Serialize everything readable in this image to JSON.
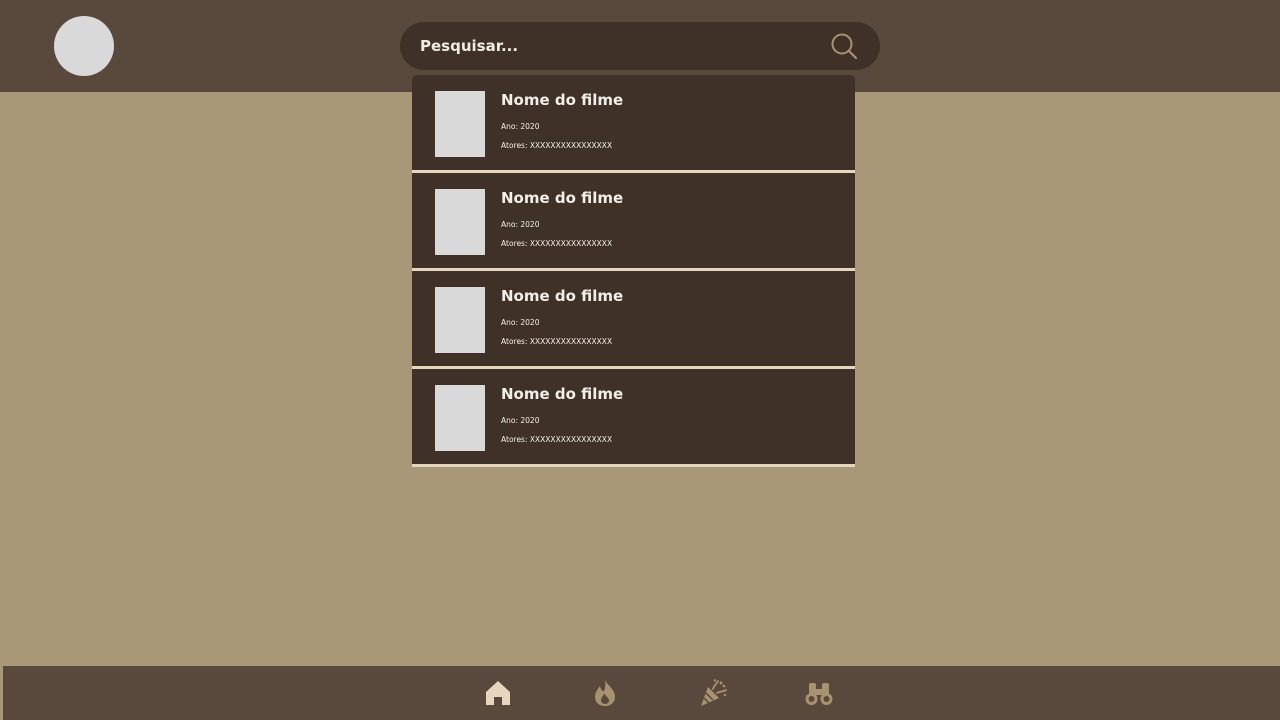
{
  "search": {
    "placeholder": "Pesquisar..."
  },
  "results": [
    {
      "title": "Nome do filme",
      "year": "Ano: 2020",
      "actors": "Atores: XXXXXXXXXXXXXXXX"
    },
    {
      "title": "Nome do filme",
      "year": "Ano: 2020",
      "actors": "Atores: XXXXXXXXXXXXXXXX"
    },
    {
      "title": "Nome do filme",
      "year": "Ano: 2020",
      "actors": "Atores: XXXXXXXXXXXXXXXX"
    },
    {
      "title": "Nome do filme",
      "year": "Ano: 2020",
      "actors": "Atores: XXXXXXXXXXXXXXXX"
    }
  ],
  "nav": {
    "items": [
      {
        "icon": "home-icon",
        "active": true
      },
      {
        "icon": "fire-icon",
        "active": false
      },
      {
        "icon": "party-popper-icon",
        "active": false
      },
      {
        "icon": "binoculars-icon",
        "active": false
      }
    ]
  },
  "colors": {
    "background": "#a89878",
    "bar": "#59493c",
    "panel": "#3f3128",
    "accent_active": "#e5d6bd",
    "accent_inactive": "#a8926f",
    "placeholder_image": "#d9d9d9"
  }
}
